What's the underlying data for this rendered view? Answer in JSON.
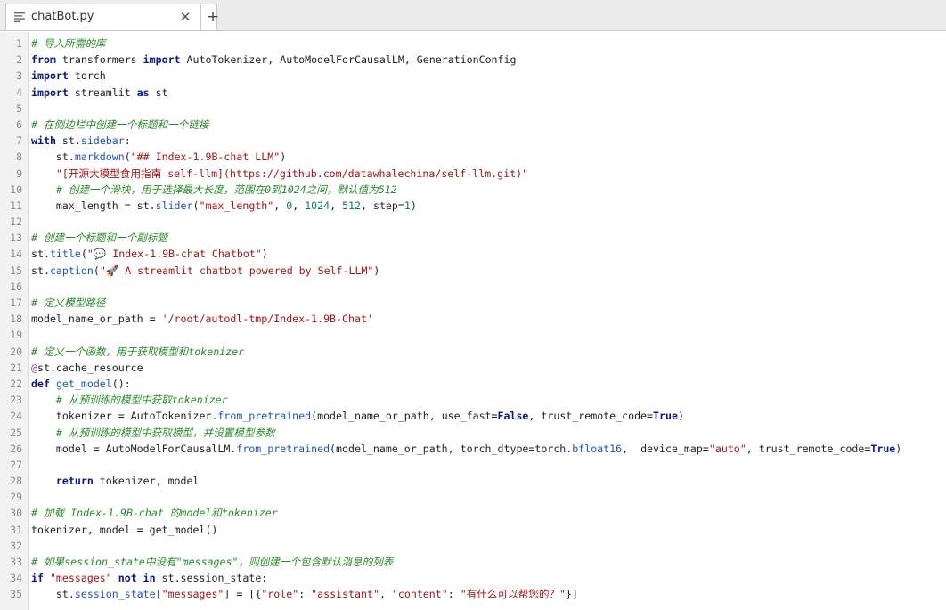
{
  "tab": {
    "title": "chatBot.py",
    "file_icon": "file-lines-icon",
    "close_icon": "close-icon",
    "add_icon": "plus-icon",
    "close_glyph": "✕",
    "add_glyph": "+"
  },
  "colors": {
    "keyword": "#0b1880",
    "string": "#a31515",
    "comment": "#2b8a2b",
    "number": "#0a7a5c",
    "function": "#1f55c0",
    "decorator": "#7a3e9d"
  },
  "code_lines": [
    {
      "num": "1",
      "segs": [
        [
          "c",
          "# 导入所需的库"
        ]
      ]
    },
    {
      "num": "2",
      "segs": [
        [
          "k",
          "from"
        ],
        [
          "p",
          " transformers "
        ],
        [
          "k",
          "import"
        ],
        [
          "p",
          " AutoTokenizer, AutoModelForCausalLM, GenerationConfig"
        ]
      ]
    },
    {
      "num": "3",
      "segs": [
        [
          "k",
          "import"
        ],
        [
          "p",
          " torch"
        ]
      ]
    },
    {
      "num": "4",
      "segs": [
        [
          "k",
          "import"
        ],
        [
          "p",
          " streamlit "
        ],
        [
          "k",
          "as"
        ],
        [
          "p",
          " st"
        ]
      ]
    },
    {
      "num": "5",
      "segs": []
    },
    {
      "num": "6",
      "segs": [
        [
          "c",
          "# 在侧边栏中创建一个标题和一个链接"
        ]
      ]
    },
    {
      "num": "7",
      "segs": [
        [
          "k",
          "with"
        ],
        [
          "p",
          " st."
        ],
        [
          "f",
          "sidebar"
        ],
        [
          "p",
          ":"
        ]
      ]
    },
    {
      "num": "8",
      "segs": [
        [
          "p",
          "    st."
        ],
        [
          "f",
          "markdown"
        ],
        [
          "p",
          "("
        ],
        [
          "s",
          "\"## Index-1.9B-chat LLM\""
        ],
        [
          "p",
          ")"
        ]
      ]
    },
    {
      "num": "9",
      "segs": [
        [
          "p",
          "    "
        ],
        [
          "s",
          "\"[开源大模型食用指南 self-llm](https://github.com/datawhalechina/self-llm.git)\""
        ]
      ]
    },
    {
      "num": "10",
      "segs": [
        [
          "p",
          "    "
        ],
        [
          "c",
          "# 创建一个滑块，用于选择最大长度，范围在0到1024之间，默认值为512"
        ]
      ]
    },
    {
      "num": "11",
      "segs": [
        [
          "p",
          "    max_length = st."
        ],
        [
          "f",
          "slider"
        ],
        [
          "p",
          "("
        ],
        [
          "s",
          "\"max_length\""
        ],
        [
          "p",
          ", "
        ],
        [
          "n",
          "0"
        ],
        [
          "p",
          ", "
        ],
        [
          "n",
          "1024"
        ],
        [
          "p",
          ", "
        ],
        [
          "n",
          "512"
        ],
        [
          "p",
          ", step="
        ],
        [
          "n",
          "1"
        ],
        [
          "p",
          ")"
        ]
      ]
    },
    {
      "num": "12",
      "segs": []
    },
    {
      "num": "13",
      "segs": [
        [
          "c",
          "# 创建一个标题和一个副标题"
        ]
      ]
    },
    {
      "num": "14",
      "segs": [
        [
          "p",
          "st."
        ],
        [
          "f",
          "title"
        ],
        [
          "p",
          "("
        ],
        [
          "s",
          "\"💬 Index-1.9B-chat Chatbot\""
        ],
        [
          "p",
          ")"
        ]
      ]
    },
    {
      "num": "15",
      "segs": [
        [
          "p",
          "st."
        ],
        [
          "f",
          "caption"
        ],
        [
          "p",
          "("
        ],
        [
          "s",
          "\"🚀 A streamlit chatbot powered by Self-LLM\""
        ],
        [
          "p",
          ")"
        ]
      ]
    },
    {
      "num": "16",
      "segs": []
    },
    {
      "num": "17",
      "segs": [
        [
          "c",
          "# 定义模型路径"
        ]
      ]
    },
    {
      "num": "18",
      "segs": [
        [
          "p",
          "model_name_or_path = "
        ],
        [
          "s",
          "'/root/autodl-tmp/Index-1.9B-Chat'"
        ]
      ]
    },
    {
      "num": "19",
      "segs": []
    },
    {
      "num": "20",
      "segs": [
        [
          "c",
          "# 定义一个函数，用于获取模型和tokenizer"
        ]
      ]
    },
    {
      "num": "21",
      "segs": [
        [
          "d",
          "@"
        ],
        [
          "p",
          "st.cache_resource"
        ]
      ]
    },
    {
      "num": "22",
      "segs": [
        [
          "k",
          "def"
        ],
        [
          "p",
          " "
        ],
        [
          "f",
          "get_model"
        ],
        [
          "p",
          "():"
        ]
      ]
    },
    {
      "num": "23",
      "segs": [
        [
          "p",
          "    "
        ],
        [
          "c",
          "# 从预训练的模型中获取tokenizer"
        ]
      ]
    },
    {
      "num": "24",
      "segs": [
        [
          "p",
          "    tokenizer = AutoTokenizer."
        ],
        [
          "f",
          "from_pretrained"
        ],
        [
          "p",
          "(model_name_or_path, use_fast="
        ],
        [
          "k",
          "False"
        ],
        [
          "p",
          ", trust_remote_code="
        ],
        [
          "k",
          "True"
        ],
        [
          "p",
          ")"
        ]
      ]
    },
    {
      "num": "25",
      "segs": [
        [
          "p",
          "    "
        ],
        [
          "c",
          "# 从预训练的模型中获取模型，并设置模型参数"
        ]
      ]
    },
    {
      "num": "26",
      "segs": [
        [
          "p",
          "    model = AutoModelForCausalLM."
        ],
        [
          "f",
          "from_pretrained"
        ],
        [
          "p",
          "(model_name_or_path, torch_dtype=torch."
        ],
        [
          "f",
          "bfloat16"
        ],
        [
          "p",
          ",  device_map="
        ],
        [
          "s",
          "\"auto\""
        ],
        [
          "p",
          ", trust_remote_code="
        ],
        [
          "k",
          "True"
        ],
        [
          "p",
          ")"
        ]
      ]
    },
    {
      "num": "27",
      "segs": []
    },
    {
      "num": "28",
      "segs": [
        [
          "p",
          "    "
        ],
        [
          "k",
          "return"
        ],
        [
          "p",
          " tokenizer, model"
        ]
      ]
    },
    {
      "num": "29",
      "segs": []
    },
    {
      "num": "30",
      "segs": [
        [
          "c",
          "# 加载 Index-1.9B-chat 的model和tokenizer"
        ]
      ]
    },
    {
      "num": "31",
      "segs": [
        [
          "p",
          "tokenizer, model = get_model()"
        ]
      ]
    },
    {
      "num": "32",
      "segs": []
    },
    {
      "num": "33",
      "segs": [
        [
          "c",
          "# 如果session_state中没有\"messages\"，则创建一个包含默认消息的列表"
        ]
      ]
    },
    {
      "num": "34",
      "segs": [
        [
          "k",
          "if"
        ],
        [
          "p",
          " "
        ],
        [
          "s",
          "\"messages\""
        ],
        [
          "p",
          " "
        ],
        [
          "k",
          "not in"
        ],
        [
          "p",
          " st.session_state:"
        ]
      ]
    },
    {
      "num": "35",
      "segs": [
        [
          "p",
          "    st."
        ],
        [
          "f",
          "session_state"
        ],
        [
          "p",
          "["
        ],
        [
          "s",
          "\"messages\""
        ],
        [
          "p",
          "] = [{"
        ],
        [
          "s",
          "\"role\""
        ],
        [
          "p",
          ": "
        ],
        [
          "s",
          "\"assistant\""
        ],
        [
          "p",
          ", "
        ],
        [
          "s",
          "\"content\""
        ],
        [
          "p",
          ": "
        ],
        [
          "s",
          "\"有什么可以帮您的？\""
        ],
        [
          "p",
          "}]"
        ]
      ]
    }
  ]
}
